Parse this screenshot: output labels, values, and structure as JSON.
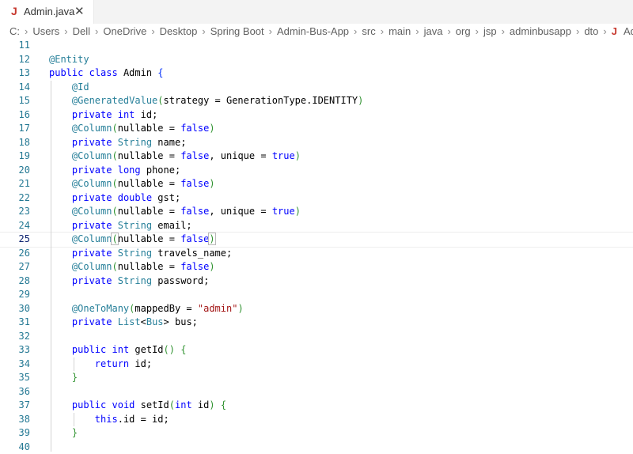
{
  "tab": {
    "icon": "J",
    "name": "Admin.java",
    "close": "✕"
  },
  "breadcrumb": [
    "C:",
    "Users",
    "Dell",
    "OneDrive",
    "Desktop",
    "Spring Boot",
    "Admin-Bus-App",
    "src",
    "main",
    "java",
    "org",
    "jsp",
    "adminbusapp",
    "dto",
    "Admin.java"
  ],
  "breadcrumb_file_icon": "J",
  "colors": {
    "keyword": "#0000ff",
    "annotation": "#267f99",
    "string": "#a31515",
    "line_number": "#237893"
  },
  "active_line": 25,
  "lines": [
    {
      "n": "11",
      "tokens": []
    },
    {
      "n": "12",
      "tokens": [
        [
          "ann",
          "@Entity"
        ]
      ]
    },
    {
      "n": "13",
      "tokens": [
        [
          "kw",
          "public"
        ],
        [
          "plain",
          " "
        ],
        [
          "kw",
          "class"
        ],
        [
          "plain",
          " Admin "
        ],
        [
          "br1",
          "{"
        ]
      ]
    },
    {
      "n": "14",
      "tokens": [
        [
          "plain",
          "    "
        ],
        [
          "ann",
          "@Id"
        ]
      ]
    },
    {
      "n": "15",
      "tokens": [
        [
          "plain",
          "    "
        ],
        [
          "ann",
          "@GeneratedValue"
        ],
        [
          "br2",
          "("
        ],
        [
          "plain",
          "strategy = GenerationType.IDENTITY"
        ],
        [
          "br2",
          ")"
        ]
      ]
    },
    {
      "n": "16",
      "tokens": [
        [
          "plain",
          "    "
        ],
        [
          "kw",
          "private"
        ],
        [
          "plain",
          " "
        ],
        [
          "kw",
          "int"
        ],
        [
          "plain",
          " id;"
        ]
      ]
    },
    {
      "n": "17",
      "tokens": [
        [
          "plain",
          "    "
        ],
        [
          "ann",
          "@Column"
        ],
        [
          "br2",
          "("
        ],
        [
          "plain",
          "nullable = "
        ],
        [
          "kw",
          "false"
        ],
        [
          "br2",
          ")"
        ]
      ]
    },
    {
      "n": "18",
      "tokens": [
        [
          "plain",
          "    "
        ],
        [
          "kw",
          "private"
        ],
        [
          "plain",
          " "
        ],
        [
          "type",
          "String"
        ],
        [
          "plain",
          " name;"
        ]
      ]
    },
    {
      "n": "19",
      "tokens": [
        [
          "plain",
          "    "
        ],
        [
          "ann",
          "@Column"
        ],
        [
          "br2",
          "("
        ],
        [
          "plain",
          "nullable = "
        ],
        [
          "kw",
          "false"
        ],
        [
          "plain",
          ", unique = "
        ],
        [
          "kw",
          "true"
        ],
        [
          "br2",
          ")"
        ]
      ]
    },
    {
      "n": "20",
      "tokens": [
        [
          "plain",
          "    "
        ],
        [
          "kw",
          "private"
        ],
        [
          "plain",
          " "
        ],
        [
          "kw",
          "long"
        ],
        [
          "plain",
          " phone;"
        ]
      ]
    },
    {
      "n": "21",
      "tokens": [
        [
          "plain",
          "    "
        ],
        [
          "ann",
          "@Column"
        ],
        [
          "br2",
          "("
        ],
        [
          "plain",
          "nullable = "
        ],
        [
          "kw",
          "false"
        ],
        [
          "br2",
          ")"
        ]
      ]
    },
    {
      "n": "22",
      "tokens": [
        [
          "plain",
          "    "
        ],
        [
          "kw",
          "private"
        ],
        [
          "plain",
          " "
        ],
        [
          "kw",
          "double"
        ],
        [
          "plain",
          " gst;"
        ]
      ]
    },
    {
      "n": "23",
      "tokens": [
        [
          "plain",
          "    "
        ],
        [
          "ann",
          "@Column"
        ],
        [
          "br2",
          "("
        ],
        [
          "plain",
          "nullable = "
        ],
        [
          "kw",
          "false"
        ],
        [
          "plain",
          ", unique = "
        ],
        [
          "kw",
          "true"
        ],
        [
          "br2",
          ")"
        ]
      ]
    },
    {
      "n": "24",
      "tokens": [
        [
          "plain",
          "    "
        ],
        [
          "kw",
          "private"
        ],
        [
          "plain",
          " "
        ],
        [
          "type",
          "String"
        ],
        [
          "plain",
          " email;"
        ]
      ]
    },
    {
      "n": "25",
      "tokens": [
        [
          "plain",
          "    "
        ],
        [
          "ann",
          "@Column"
        ],
        [
          "br2m",
          "("
        ],
        [
          "plain",
          "nullable = "
        ],
        [
          "kw",
          "false"
        ],
        [
          "br2m",
          ")"
        ]
      ]
    },
    {
      "n": "26",
      "tokens": [
        [
          "plain",
          "    "
        ],
        [
          "kw",
          "private"
        ],
        [
          "plain",
          " "
        ],
        [
          "type",
          "String"
        ],
        [
          "plain",
          " travels_name;"
        ]
      ]
    },
    {
      "n": "27",
      "tokens": [
        [
          "plain",
          "    "
        ],
        [
          "ann",
          "@Column"
        ],
        [
          "br2",
          "("
        ],
        [
          "plain",
          "nullable = "
        ],
        [
          "kw",
          "false"
        ],
        [
          "br2",
          ")"
        ]
      ]
    },
    {
      "n": "28",
      "tokens": [
        [
          "plain",
          "    "
        ],
        [
          "kw",
          "private"
        ],
        [
          "plain",
          " "
        ],
        [
          "type",
          "String"
        ],
        [
          "plain",
          " password;"
        ]
      ]
    },
    {
      "n": "29",
      "tokens": []
    },
    {
      "n": "30",
      "tokens": [
        [
          "plain",
          "    "
        ],
        [
          "ann",
          "@OneToMany"
        ],
        [
          "br2",
          "("
        ],
        [
          "plain",
          "mappedBy = "
        ],
        [
          "str",
          "\"admin\""
        ],
        [
          "br2",
          ")"
        ]
      ]
    },
    {
      "n": "31",
      "tokens": [
        [
          "plain",
          "    "
        ],
        [
          "kw",
          "private"
        ],
        [
          "plain",
          " "
        ],
        [
          "type",
          "List"
        ],
        [
          "plain",
          "<"
        ],
        [
          "type",
          "Bus"
        ],
        [
          "plain",
          "> bus;"
        ]
      ]
    },
    {
      "n": "32",
      "tokens": []
    },
    {
      "n": "33",
      "tokens": [
        [
          "plain",
          "    "
        ],
        [
          "kw",
          "public"
        ],
        [
          "plain",
          " "
        ],
        [
          "kw",
          "int"
        ],
        [
          "plain",
          " getId"
        ],
        [
          "br2",
          "()"
        ],
        [
          "plain",
          " "
        ],
        [
          "br2",
          "{"
        ]
      ]
    },
    {
      "n": "34",
      "tokens": [
        [
          "plain",
          "        "
        ],
        [
          "kw",
          "return"
        ],
        [
          "plain",
          " id;"
        ]
      ]
    },
    {
      "n": "35",
      "tokens": [
        [
          "plain",
          "    "
        ],
        [
          "br2",
          "}"
        ]
      ]
    },
    {
      "n": "36",
      "tokens": []
    },
    {
      "n": "37",
      "tokens": [
        [
          "plain",
          "    "
        ],
        [
          "kw",
          "public"
        ],
        [
          "plain",
          " "
        ],
        [
          "kw",
          "void"
        ],
        [
          "plain",
          " setId"
        ],
        [
          "br2",
          "("
        ],
        [
          "kw",
          "int"
        ],
        [
          "plain",
          " id"
        ],
        [
          "br2",
          ")"
        ],
        [
          "plain",
          " "
        ],
        [
          "br2",
          "{"
        ]
      ]
    },
    {
      "n": "38",
      "tokens": [
        [
          "plain",
          "        "
        ],
        [
          "kw",
          "this"
        ],
        [
          "plain",
          ".id = id;"
        ]
      ]
    },
    {
      "n": "39",
      "tokens": [
        [
          "plain",
          "    "
        ],
        [
          "br2",
          "}"
        ]
      ]
    },
    {
      "n": "40",
      "tokens": []
    }
  ]
}
